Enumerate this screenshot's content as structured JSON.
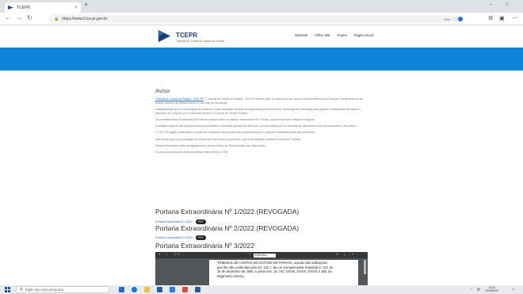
{
  "browser": {
    "tab_title": "TCEPR",
    "tab_close": "×",
    "new_tab": "+",
    "url": "https://www3.tce.pr.gov.br",
    "zoom": "75%",
    "window_controls": [
      "–",
      "□"
    ]
  },
  "site": {
    "brand": "TCEPR",
    "subtitle": "Tribunal de Contas do Estado do Paraná",
    "nav": [
      "Webmail",
      "Office 365",
      "Teams",
      "Página Inicial"
    ],
    "banner_color": "#0e84d8"
  },
  "content": {
    "aviso_title": "Aviso",
    "paragraphs": [
      "O Tribunal de Contas do Paraná - TCE-PR informa que, no último período, houve uma intermitência nos serviços, em decorrência de ajustes técnicos de infraestrutura em sua rede de tecnologia.",
      "Imediatamente após a confirmação do problema, foram adotadas medidas de segurança pela Diretoria de Tecnologia da Informação para garantir a integridade dos dados e sistemas, em conjunto com a Diretoria Jurídica e a Escola de Gestão Pública.",
      "Os procedimentos já realizados não tiveram impacto sobre os dados e documentos do Tribunal, que permanecem íntegros e seguros.",
      "A atuação conjunta das equipes técnicas possibilitou a retomada gradual dos serviços, com prioridade para os sistemas de atendimento aos jurisdicionados e ao público.",
      "O TCE-PR segue monitorando os sistemas e adotando as providências necessárias para o completo restabelecimento das atividades.",
      "Não houve prejuízo à prestação de contas nem aos prazos processuais, que serão tratados conforme normas do Tribunal.",
      "Novas informações serão divulgadas pelos canais oficiais do Tribunal assim que disponíveis.",
      "Os prazos processuais estão suspensos entre 15/08 e 17/08."
    ],
    "link_text": "Tribunal de Contas do Paraná - TCE-PR"
  },
  "portarias": [
    {
      "title": "Portaria Extraordinária Nº 1/2022 (REVOGADA)",
      "link": "Portaria Extraordinária Nº 1/2022",
      "badge": "PDF"
    },
    {
      "title": "Portaria Extraordinária Nº 2/2022 (REVOGADA)",
      "link": "Portaria Extraordinária Nº 2/2022",
      "badge": "PDF"
    },
    {
      "title": "Portaria Extraordinária Nº 3/2022"
    }
  ],
  "pdf": {
    "page_info": "1 / 1",
    "zoom_label": "Automático",
    "lines": [
      "TRIBUNAL DE CONTAS DO ESTADO DO PARANÁ, usando das atribuições",
      "que lhe são conferidas pelo art. 122, I, da Lei Complementar Estadual nº 113, de",
      "15 de dezembro de 2005, e pelos arts. 16, XIV, XXXIII, XXXIV, XXXIX e 189, do",
      "Regimento Interno,"
    ]
  },
  "taskbar": {
    "search_placeholder": "Digite aqui para pesquisar",
    "clock_line1": "10:02",
    "clock_line2": "24/08/2022"
  }
}
